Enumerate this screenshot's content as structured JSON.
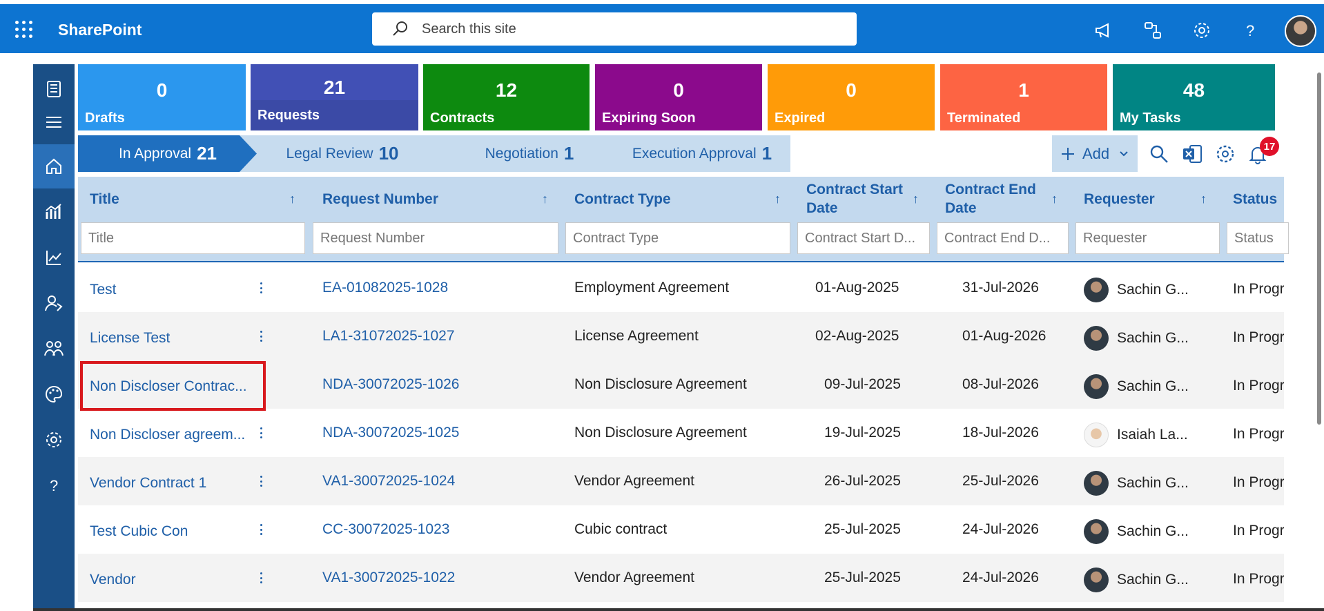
{
  "header": {
    "brand": "SharePoint",
    "search_placeholder": "Search this site"
  },
  "tiles": [
    {
      "count": "0",
      "label": "Drafts",
      "color": "#2b97ee"
    },
    {
      "count": "21",
      "label": "Requests",
      "color": "#4150b5"
    },
    {
      "count": "12",
      "label": "Contracts",
      "color": "#0d8a0f"
    },
    {
      "count": "0",
      "label": "Expiring Soon",
      "color": "#8b0a8c"
    },
    {
      "count": "0",
      "label": "Expired",
      "color": "#ff9b08"
    },
    {
      "count": "1",
      "label": "Terminated",
      "color": "#fd6443"
    },
    {
      "count": "48",
      "label": "My Tasks",
      "color": "#018584"
    }
  ],
  "stages": [
    {
      "label": "In Approval",
      "count": "21"
    },
    {
      "label": "Legal Review",
      "count": "10"
    },
    {
      "label": "Negotiation",
      "count": "1"
    },
    {
      "label": "Execution Approval",
      "count": "1"
    }
  ],
  "toolbar": {
    "add_label": "Add",
    "notification_count": "17"
  },
  "columns": [
    {
      "label": "Title",
      "filter_placeholder": "Title"
    },
    {
      "label": "Request Number",
      "filter_placeholder": "Request Number"
    },
    {
      "label": "Contract Type",
      "filter_placeholder": "Contract Type"
    },
    {
      "label": "Contract Start Date",
      "filter_placeholder": "Contract Start D..."
    },
    {
      "label": "Contract End Date",
      "filter_placeholder": "Contract End D..."
    },
    {
      "label": "Requester",
      "filter_placeholder": "Requester"
    },
    {
      "label": "Status",
      "filter_placeholder": "Status"
    }
  ],
  "rows": [
    {
      "title": "Test",
      "request_number": "EA-01082025-1028",
      "contract_type": "Employment Agreement",
      "start": "01-Aug-2025",
      "end": "31-Jul-2026",
      "requester": "Sachin G...",
      "status": "In Progr"
    },
    {
      "title": "License Test",
      "request_number": "LA1-31072025-1027",
      "contract_type": "License Agreement",
      "start": "02-Aug-2025",
      "end": "01-Aug-2026",
      "requester": "Sachin G...",
      "status": "In Progr"
    },
    {
      "title": "Non Discloser Contrac...",
      "request_number": "NDA-30072025-1026",
      "contract_type": "Non Disclosure Agreement",
      "start": "09-Jul-2025",
      "end": "08-Jul-2026",
      "requester": "Sachin G...",
      "status": "In Progr"
    },
    {
      "title": "Non Discloser agreem...",
      "request_number": "NDA-30072025-1025",
      "contract_type": "Non Disclosure Agreement",
      "start": "19-Jul-2025",
      "end": "18-Jul-2026",
      "requester": "Isaiah La...",
      "status": "In Progr"
    },
    {
      "title": "Vendor Contract 1",
      "request_number": "VA1-30072025-1024",
      "contract_type": "Vendor Agreement",
      "start": "26-Jul-2025",
      "end": "25-Jul-2026",
      "requester": "Sachin G...",
      "status": "In Progr"
    },
    {
      "title": "Test Cubic Con",
      "request_number": "CC-30072025-1023",
      "contract_type": "Cubic contract",
      "start": "25-Jul-2025",
      "end": "24-Jul-2026",
      "requester": "Sachin G...",
      "status": "In Progr"
    },
    {
      "title": "Vendor",
      "request_number": "VA1-30072025-1022",
      "contract_type": "Vendor Agreement",
      "start": "25-Jul-2025",
      "end": "24-Jul-2026",
      "requester": "Sachin G...",
      "status": "In Progr"
    }
  ]
}
